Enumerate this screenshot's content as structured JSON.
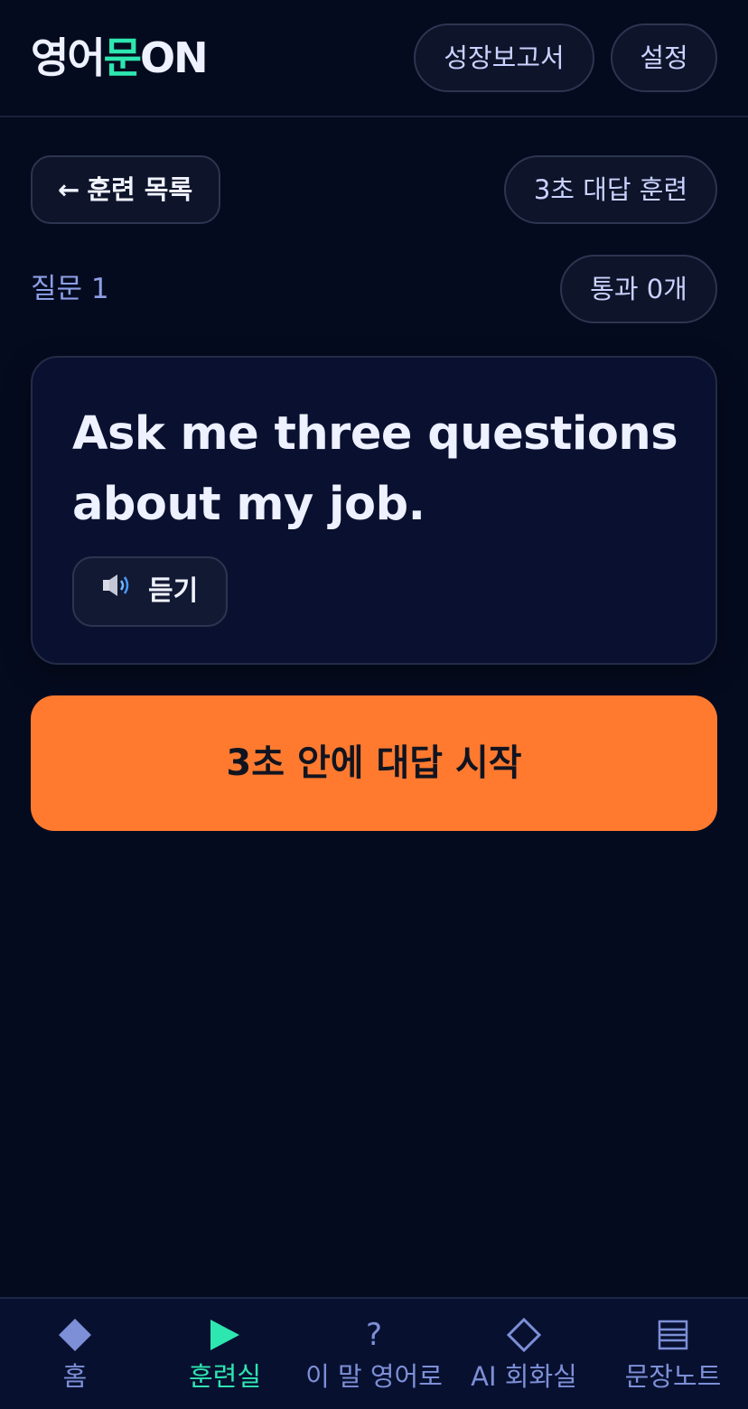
{
  "header": {
    "logo_prefix": "영어",
    "logo_accent": "문",
    "logo_suffix": "ON",
    "report_label": "성장보고서",
    "settings_label": "설정"
  },
  "subnav": {
    "back_arrow": "←",
    "back_label": "훈련 목록",
    "mode_label": "3초 대답 훈련"
  },
  "question": {
    "number_label": "질문 1",
    "pass_label": "통과 0개",
    "prompt": "Ask me three questions about my job.",
    "listen_label": "듣기"
  },
  "cta": {
    "label": "3초 안에 대답 시작"
  },
  "tabs": [
    {
      "label": "홈",
      "icon": "diamond-filled-icon",
      "active": false
    },
    {
      "label": "훈련실",
      "icon": "play-icon",
      "active": true
    },
    {
      "label": "이 말 영어로",
      "icon": "question-icon",
      "active": false
    },
    {
      "label": "AI 회화실",
      "icon": "diamond-outline-icon",
      "active": false
    },
    {
      "label": "문장노트",
      "icon": "list-icon",
      "active": false
    }
  ],
  "icon_glyphs": {
    "question": "?"
  },
  "colors": {
    "background": "#050b1f",
    "accent_green": "#2ee6b0",
    "cta_orange": "#ff7a2f",
    "muted_blue": "#7d8fd6"
  }
}
